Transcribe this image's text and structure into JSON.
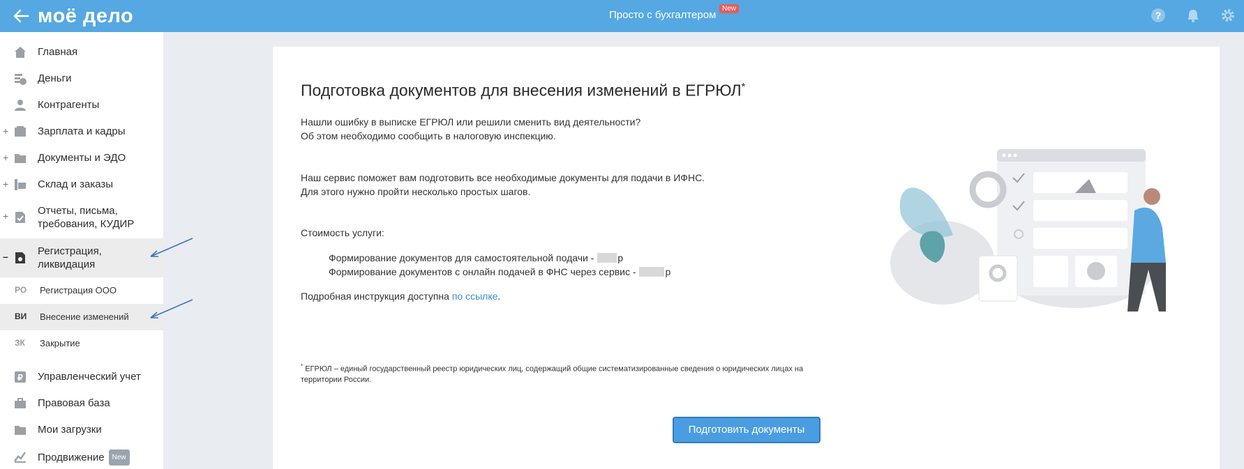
{
  "header": {
    "logo": "моё дело",
    "center_title": "Просто с бухгалтером",
    "new_badge": "New"
  },
  "sidebar": {
    "items": [
      {
        "label": "Главная",
        "icon": "home-icon"
      },
      {
        "label": "Деньги",
        "icon": "money-icon"
      },
      {
        "label": "Контрагенты",
        "icon": "contractors-icon"
      },
      {
        "label": "Зарплата и кадры",
        "icon": "salary-icon",
        "expandable": "+"
      },
      {
        "label": "Документы и ЭДО",
        "icon": "documents-icon",
        "expandable": "+"
      },
      {
        "label": "Склад и заказы",
        "icon": "warehouse-icon",
        "expandable": "+"
      },
      {
        "label_line1": "Отчеты, письма,",
        "label_line2": "требования, КУДИР",
        "icon": "reports-icon",
        "expandable": "+"
      },
      {
        "label_line1": "Регистрация,",
        "label_line2": "ликвидация",
        "icon": "registration-icon",
        "expandable": "–",
        "active": true
      },
      {
        "label": "Управленческий учет",
        "icon": "management-accounting-icon"
      },
      {
        "label": "Правовая база",
        "icon": "legal-base-icon"
      },
      {
        "label": "Мои загрузки",
        "icon": "downloads-icon"
      },
      {
        "label": "Продвижение",
        "icon": "promotion-icon",
        "badge": "New"
      }
    ],
    "subitems": [
      {
        "abbr": "РО",
        "label": "Регистрация ООО"
      },
      {
        "abbr": "ВИ",
        "label": "Внесение изменений",
        "active": true
      },
      {
        "abbr": "ЗК",
        "label": "Закрытие"
      }
    ]
  },
  "main": {
    "title": "Подготовка документов для внесения изменений в ЕГРЮЛ",
    "title_mark": "*",
    "p1_line1": "Нашли ошибку в выписке ЕГРЮЛ или решили сменить вид деятельности?",
    "p1_line2": "Об этом необходимо сообщить в налоговую инспекцию.",
    "p2_line1": "Наш сервис поможет вам подготовить все необходимые документы для подачи в ИФНС.",
    "p2_line2": "Для этого нужно пройти несколько простых шагов.",
    "price_heading": "Стоимость услуги:",
    "price1_text": "Формирование документов для самостоятельной подачи -",
    "price1_suffix": "р",
    "price2_text": "Формирование документов с онлайн подачей в ФНС через сервис -",
    "price2_suffix": "р",
    "instruction_text": "Подробная инструкция доступна",
    "instruction_link": "по ссылке",
    "instruction_end": ".",
    "footnote_mark": "*",
    "footnote": "ЕГРЮЛ – единый государственный реестр юридических лиц, содержащий общие систематизированные сведения о юридических лицах на территории России.",
    "primary_button": "Подготовить документы"
  },
  "colors": {
    "header": "#55a8e1",
    "accent": "#4a9de0",
    "link": "#3a8fd0",
    "badge_red": "#e85c5c",
    "annotation_arrow": "#3b74b8"
  }
}
